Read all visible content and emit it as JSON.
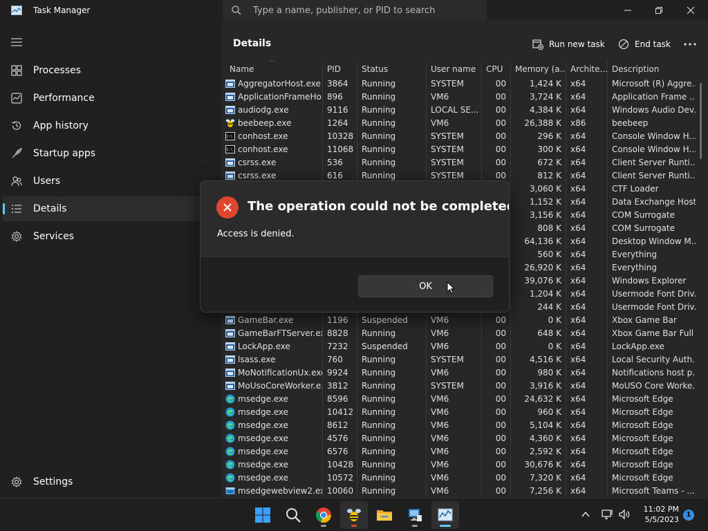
{
  "window": {
    "title": "Task Manager"
  },
  "search": {
    "placeholder": "Type a name, publisher, or PID to search"
  },
  "sidebar": {
    "items": [
      {
        "label": "Processes",
        "icon": "processes-icon"
      },
      {
        "label": "Performance",
        "icon": "performance-icon"
      },
      {
        "label": "App history",
        "icon": "history-icon"
      },
      {
        "label": "Startup apps",
        "icon": "startup-icon"
      },
      {
        "label": "Users",
        "icon": "users-icon"
      },
      {
        "label": "Details",
        "icon": "details-icon",
        "active": true
      },
      {
        "label": "Services",
        "icon": "services-icon"
      }
    ],
    "settings_label": "Settings"
  },
  "main": {
    "title": "Details",
    "run_new_task": "Run new task",
    "end_task": "End task"
  },
  "table": {
    "columns": [
      "Name",
      "PID",
      "Status",
      "User name",
      "CPU",
      "Memory (a...",
      "Archite...",
      "Description"
    ],
    "rows": [
      {
        "icon": "app",
        "name": "AggregatorHost.exe",
        "pid": "3864",
        "status": "Running",
        "user": "SYSTEM",
        "cpu": "00",
        "mem": "1,424 K",
        "arch": "x64",
        "desc": "Microsoft (R) Aggre..."
      },
      {
        "icon": "app",
        "name": "ApplicationFrameHo...",
        "pid": "896",
        "status": "Running",
        "user": "VM6",
        "cpu": "00",
        "mem": "3,724 K",
        "arch": "x64",
        "desc": "Application Frame ..."
      },
      {
        "icon": "app",
        "name": "audiodg.exe",
        "pid": "9116",
        "status": "Running",
        "user": "LOCAL SE...",
        "cpu": "00",
        "mem": "4,384 K",
        "arch": "x64",
        "desc": "Windows Audio Dev..."
      },
      {
        "icon": "bee",
        "name": "beebeep.exe",
        "pid": "1264",
        "status": "Running",
        "user": "VM6",
        "cpu": "00",
        "mem": "26,388 K",
        "arch": "x86",
        "desc": "beebeep"
      },
      {
        "icon": "console",
        "name": "conhost.exe",
        "pid": "10328",
        "status": "Running",
        "user": "SYSTEM",
        "cpu": "00",
        "mem": "296 K",
        "arch": "x64",
        "desc": "Console Window H..."
      },
      {
        "icon": "console",
        "name": "conhost.exe",
        "pid": "11068",
        "status": "Running",
        "user": "SYSTEM",
        "cpu": "00",
        "mem": "300 K",
        "arch": "x64",
        "desc": "Console Window H..."
      },
      {
        "icon": "app",
        "name": "csrss.exe",
        "pid": "536",
        "status": "Running",
        "user": "SYSTEM",
        "cpu": "00",
        "mem": "672 K",
        "arch": "x64",
        "desc": "Client Server Runti..."
      },
      {
        "icon": "app",
        "name": "csrss.exe",
        "pid": "616",
        "status": "Running",
        "user": "SYSTEM",
        "cpu": "00",
        "mem": "812 K",
        "arch": "x64",
        "desc": "Client Server Runti..."
      },
      {
        "icon": "",
        "name": "",
        "pid": "",
        "status": "",
        "user": "",
        "cpu": "",
        "mem": "3,060 K",
        "arch": "x64",
        "desc": "CTF Loader"
      },
      {
        "icon": "",
        "name": "",
        "pid": "",
        "status": "",
        "user": "",
        "cpu": "",
        "mem": "1,152 K",
        "arch": "x64",
        "desc": "Data Exchange Host"
      },
      {
        "icon": "",
        "name": "",
        "pid": "",
        "status": "",
        "user": "",
        "cpu": "",
        "mem": "3,156 K",
        "arch": "x64",
        "desc": "COM Surrogate"
      },
      {
        "icon": "",
        "name": "",
        "pid": "",
        "status": "",
        "user": "",
        "cpu": "",
        "mem": "808 K",
        "arch": "x64",
        "desc": "COM Surrogate"
      },
      {
        "icon": "",
        "name": "",
        "pid": "",
        "status": "",
        "user": "",
        "cpu": "",
        "mem": "64,136 K",
        "arch": "x64",
        "desc": "Desktop Window M..."
      },
      {
        "icon": "",
        "name": "",
        "pid": "",
        "status": "",
        "user": "",
        "cpu": "",
        "mem": "560 K",
        "arch": "x64",
        "desc": "Everything"
      },
      {
        "icon": "",
        "name": "",
        "pid": "",
        "status": "",
        "user": "",
        "cpu": "",
        "mem": "26,920 K",
        "arch": "x64",
        "desc": "Everything"
      },
      {
        "icon": "",
        "name": "",
        "pid": "",
        "status": "",
        "user": "",
        "cpu": "",
        "mem": "39,076 K",
        "arch": "x64",
        "desc": "Windows Explorer"
      },
      {
        "icon": "",
        "name": "",
        "pid": "",
        "status": "",
        "user": "",
        "cpu": "",
        "mem": "1,204 K",
        "arch": "x64",
        "desc": "Usermode Font Driv..."
      },
      {
        "icon": "",
        "name": "",
        "pid": "",
        "status": "",
        "user": "",
        "cpu": "",
        "mem": "244 K",
        "arch": "x64",
        "desc": "Usermode Font Driv..."
      },
      {
        "icon": "app",
        "name": "GameBar.exe",
        "pid": "1196",
        "status": "Suspended",
        "user": "VM6",
        "cpu": "00",
        "mem": "0 K",
        "arch": "x64",
        "desc": "Xbox Game Bar"
      },
      {
        "icon": "app",
        "name": "GameBarFTServer.exe",
        "pid": "8828",
        "status": "Running",
        "user": "VM6",
        "cpu": "00",
        "mem": "648 K",
        "arch": "x64",
        "desc": "Xbox Game Bar Full ..."
      },
      {
        "icon": "app",
        "name": "LockApp.exe",
        "pid": "7232",
        "status": "Suspended",
        "user": "VM6",
        "cpu": "00",
        "mem": "0 K",
        "arch": "x64",
        "desc": "LockApp.exe"
      },
      {
        "icon": "app",
        "name": "lsass.exe",
        "pid": "760",
        "status": "Running",
        "user": "SYSTEM",
        "cpu": "00",
        "mem": "4,516 K",
        "arch": "x64",
        "desc": "Local Security Auth..."
      },
      {
        "icon": "app",
        "name": "MoNotificationUx.exe",
        "pid": "9924",
        "status": "Running",
        "user": "VM6",
        "cpu": "00",
        "mem": "980 K",
        "arch": "x64",
        "desc": "Notifications host p..."
      },
      {
        "icon": "app",
        "name": "MoUsoCoreWorker.e...",
        "pid": "3812",
        "status": "Running",
        "user": "SYSTEM",
        "cpu": "00",
        "mem": "3,916 K",
        "arch": "x64",
        "desc": "MoUSO Core Worke..."
      },
      {
        "icon": "edge",
        "name": "msedge.exe",
        "pid": "8596",
        "status": "Running",
        "user": "VM6",
        "cpu": "00",
        "mem": "24,632 K",
        "arch": "x64",
        "desc": "Microsoft Edge"
      },
      {
        "icon": "edge",
        "name": "msedge.exe",
        "pid": "10412",
        "status": "Running",
        "user": "VM6",
        "cpu": "00",
        "mem": "960 K",
        "arch": "x64",
        "desc": "Microsoft Edge"
      },
      {
        "icon": "edge",
        "name": "msedge.exe",
        "pid": "8612",
        "status": "Running",
        "user": "VM6",
        "cpu": "00",
        "mem": "5,104 K",
        "arch": "x64",
        "desc": "Microsoft Edge"
      },
      {
        "icon": "edge",
        "name": "msedge.exe",
        "pid": "4576",
        "status": "Running",
        "user": "VM6",
        "cpu": "00",
        "mem": "4,360 K",
        "arch": "x64",
        "desc": "Microsoft Edge"
      },
      {
        "icon": "edge",
        "name": "msedge.exe",
        "pid": "6576",
        "status": "Running",
        "user": "VM6",
        "cpu": "00",
        "mem": "2,592 K",
        "arch": "x64",
        "desc": "Microsoft Edge"
      },
      {
        "icon": "edge",
        "name": "msedge.exe",
        "pid": "10428",
        "status": "Running",
        "user": "VM6",
        "cpu": "00",
        "mem": "30,676 K",
        "arch": "x64",
        "desc": "Microsoft Edge"
      },
      {
        "icon": "edge",
        "name": "msedge.exe",
        "pid": "10572",
        "status": "Running",
        "user": "VM6",
        "cpu": "00",
        "mem": "7,320 K",
        "arch": "x64",
        "desc": "Microsoft Edge"
      },
      {
        "icon": "webview",
        "name": "msedgewebview2.exe",
        "pid": "10060",
        "status": "Running",
        "user": "VM6",
        "cpu": "00",
        "mem": "7,256 K",
        "arch": "x64",
        "desc": "Microsoft Teams - ..."
      }
    ]
  },
  "dialog": {
    "title": "The operation could not be completed.",
    "message": "Access is denied.",
    "ok_label": "OK"
  },
  "taskbar": {
    "apps": [
      "windows-start-icon",
      "search-icon",
      "chrome-icon",
      "beebeep-icon",
      "file-explorer-icon",
      "remote-desktop-icon",
      "task-manager-icon"
    ],
    "time": "11:02 PM",
    "date": "5/5/2023",
    "notification_count": "1"
  },
  "colors": {
    "accent": "#60cdff",
    "error": "#e0462f",
    "edge": "#1e9bd7"
  }
}
